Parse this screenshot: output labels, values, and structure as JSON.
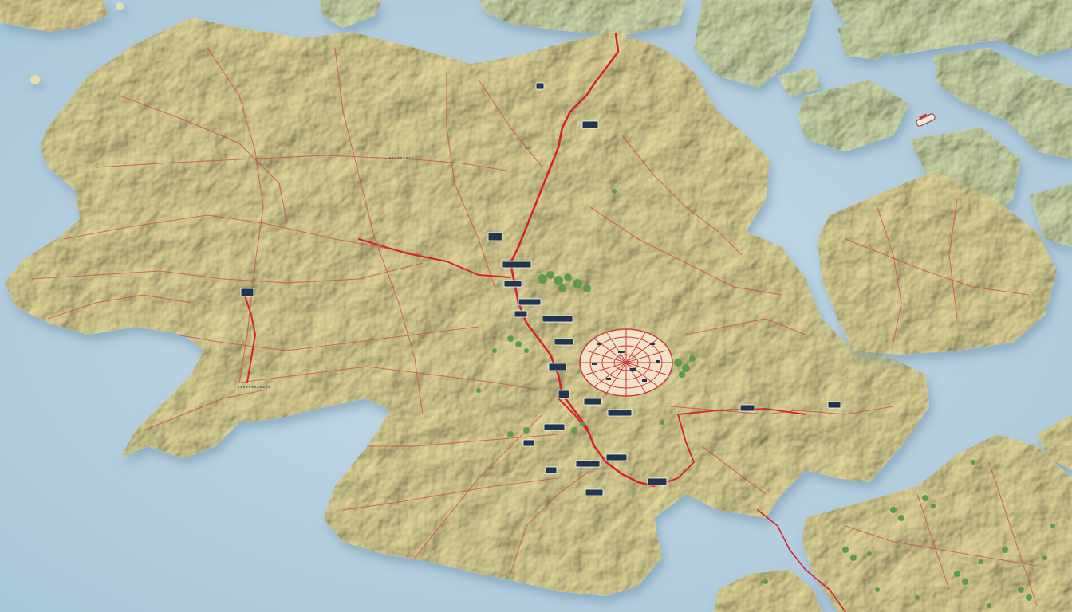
{
  "map": {
    "colors": {
      "water": "#b9d3e2",
      "water_deep": "#a9c6d8",
      "shallow": "#d6e6ee",
      "land_main": "#eadfa0",
      "land_highlight": "#f6efc6",
      "land_shadow": "#c7b574",
      "land_green": "#d9e3b2",
      "land_green_shadow": "#a9bb84",
      "main_road": "#d8222a",
      "minor_road": "#cf4a44",
      "trees": "#5f9a4a",
      "city": "#c93a3a",
      "label_bg": "#1f3550"
    },
    "labels": [
      {
        "id": "town-north",
        "text": ""
      },
      {
        "id": "town-northeast",
        "text": ""
      },
      {
        "id": "pass-name",
        "text": ""
      },
      {
        "id": "town-west",
        "text": ""
      },
      {
        "id": "river-label",
        "text": ""
      },
      {
        "id": "town-center-a",
        "text": ""
      },
      {
        "id": "town-center-b",
        "text": ""
      },
      {
        "id": "town-center-c",
        "text": ""
      },
      {
        "id": "town-center-d",
        "text": ""
      },
      {
        "id": "town-center-e",
        "text": ""
      },
      {
        "id": "town-south-a",
        "text": ""
      },
      {
        "id": "town-south-b",
        "text": ""
      },
      {
        "id": "town-south-c",
        "text": ""
      },
      {
        "id": "town-south-d",
        "text": ""
      },
      {
        "id": "town-east",
        "text": ""
      },
      {
        "id": "town-southeast",
        "text": ""
      }
    ],
    "icons": [
      "mountain-relief",
      "city-grid",
      "forest-cluster",
      "ship"
    ]
  }
}
